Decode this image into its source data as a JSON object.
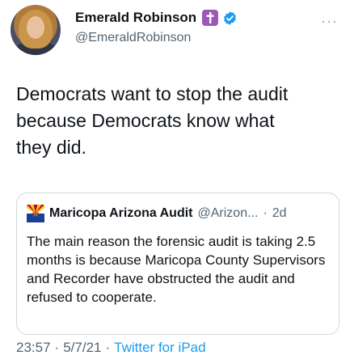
{
  "tweet": {
    "author_name": "Emerald Robinson",
    "author_handle": "@EmeraldRobinson",
    "text": "Democrats want to stop the audit\nbecause Democrats know what\nthey did.",
    "time": "23:57",
    "separator": "·",
    "date": "5/7/21",
    "source": "Twitter for iPad"
  },
  "quoted": {
    "author_name": "Maricopa Arizona Audit",
    "author_handle": "@Arizon...",
    "separator": "·",
    "age": "2d",
    "text": "The main reason the forensic audit is taking 2.5 months is because Maricopa County Supervisors and Recorder have obstructed the audit and refused to cooperate."
  },
  "icons": {
    "more": "more-horizontal-icon",
    "badge": "cross-badge-icon",
    "verified": "verified-badge-icon",
    "quote_avatar": "arizona-flag-icon"
  },
  "colors": {
    "link": "#1d9bf0",
    "secondary_text": "#536471",
    "badge_purple": "#9b59b6",
    "border": "#cfd9de"
  }
}
